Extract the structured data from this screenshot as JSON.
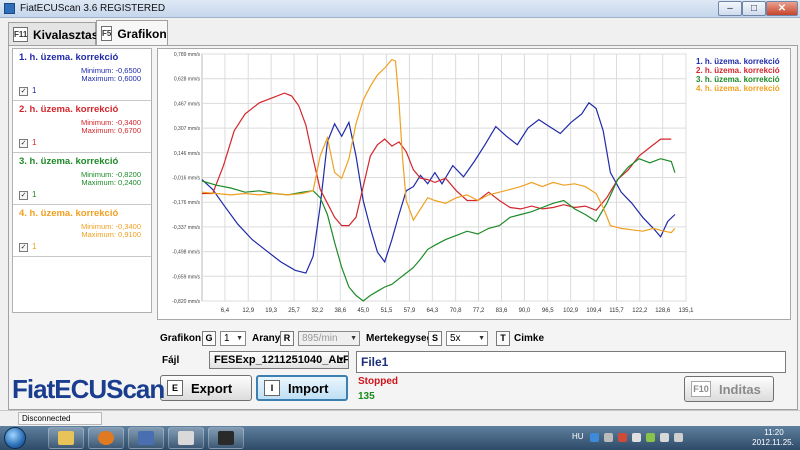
{
  "window": {
    "title": "FiatECUScan 3.6 REGISTERED",
    "minimize": "–",
    "maximize": "□",
    "close": "✕"
  },
  "tabs": [
    {
      "key": "F11",
      "label": "Kivalasztas",
      "active": false
    },
    {
      "key": "F5",
      "label": "Grafikon",
      "active": true
    }
  ],
  "channels": [
    {
      "title": "1. h. üzema. korrekció",
      "min": "Minimum: -0,6500",
      "max": "Maximum: 0,6000",
      "num": "1",
      "color": "#1f2aa8"
    },
    {
      "title": "2. h. üzema. korrekció",
      "min": "Minimum: -0,3400",
      "max": "Maximum: 0,6700",
      "num": "1",
      "color": "#d3262c"
    },
    {
      "title": "3. h. üzema. korrekció",
      "min": "Minimum: -0,8200",
      "max": "Maximum: 0,2400",
      "num": "1",
      "color": "#1d8a28"
    },
    {
      "title": "4. h. üzema. korrekció",
      "min": "Minimum: -0,3400",
      "max": "Maximum: 0,9100",
      "num": "1",
      "color": "#f0a020"
    }
  ],
  "chart_data": {
    "type": "line",
    "y_ticks": [
      "0,789 mm/s",
      "0,628 mm/s",
      "0,467 mm/s",
      "0,307 mm/s",
      "0,146 mm/s",
      "-0,016 mm/s",
      "-0,176 mm/s",
      "-0,337 mm/s",
      "-0,498 mm/s",
      "-0,659 mm/s",
      "-0,820 mm/s"
    ],
    "x_ticks": [
      "6,4",
      "12,9",
      "19,3",
      "25,7",
      "32,2",
      "38,6",
      "45,0",
      "51,5",
      "57,9",
      "64,3",
      "70,8",
      "77,2",
      "83,6",
      "90,0",
      "96,5",
      "102,9",
      "109,4",
      "115,7",
      "122,2",
      "128,6",
      "135,1"
    ],
    "xlim": [
      0,
      135.1
    ],
    "ylim": [
      -0.82,
      0.95
    ],
    "grid": true,
    "legend_position": "top-right",
    "series": [
      {
        "name": "1. h. üzema. korrekció",
        "color": "#1f2aa8",
        "points": [
          [
            0,
            0.05
          ],
          [
            3,
            -0.02
          ],
          [
            6,
            -0.13
          ],
          [
            10,
            -0.27
          ],
          [
            14,
            -0.38
          ],
          [
            18,
            -0.46
          ],
          [
            22,
            -0.54
          ],
          [
            26,
            -0.6
          ],
          [
            29,
            -0.62
          ],
          [
            31,
            -0.5
          ],
          [
            33,
            -0.14
          ],
          [
            35,
            0.32
          ],
          [
            37,
            0.45
          ],
          [
            39,
            0.36
          ],
          [
            41,
            0.46
          ],
          [
            43,
            0.22
          ],
          [
            45,
            -0.1
          ],
          [
            47,
            -0.3
          ],
          [
            49,
            -0.47
          ],
          [
            51,
            -0.54
          ],
          [
            53,
            -0.38
          ],
          [
            55,
            -0.2
          ],
          [
            57,
            -0.03
          ],
          [
            59,
            0.0
          ],
          [
            61,
            0.08
          ],
          [
            63,
            0.02
          ],
          [
            65,
            0.1
          ],
          [
            67,
            0.02
          ],
          [
            70,
            0.15
          ],
          [
            73,
            0.07
          ],
          [
            76,
            0.18
          ],
          [
            79,
            0.3
          ],
          [
            82,
            0.43
          ],
          [
            85,
            0.36
          ],
          [
            88,
            0.3
          ],
          [
            91,
            0.42
          ],
          [
            94,
            0.48
          ],
          [
            97,
            0.43
          ],
          [
            100,
            0.38
          ],
          [
            103,
            0.46
          ],
          [
            106,
            0.52
          ],
          [
            108,
            0.6
          ],
          [
            110,
            0.56
          ],
          [
            112,
            0.4
          ],
          [
            114,
            0.1
          ],
          [
            117,
            -0.04
          ],
          [
            120,
            -0.12
          ],
          [
            123,
            -0.22
          ],
          [
            126,
            -0.3
          ],
          [
            128,
            -0.36
          ],
          [
            130,
            -0.25
          ],
          [
            132,
            -0.2
          ]
        ]
      },
      {
        "name": "2. h. üzema. korrekció",
        "color": "#d3262c",
        "points": [
          [
            0,
            -0.05
          ],
          [
            3,
            -0.05
          ],
          [
            6,
            0.15
          ],
          [
            9,
            0.4
          ],
          [
            12,
            0.52
          ],
          [
            16,
            0.6
          ],
          [
            20,
            0.64
          ],
          [
            23,
            0.67
          ],
          [
            25,
            0.65
          ],
          [
            27,
            0.58
          ],
          [
            29,
            0.44
          ],
          [
            31,
            0.2
          ],
          [
            33,
            -0.02
          ],
          [
            35,
            -0.12
          ],
          [
            37,
            -0.22
          ],
          [
            39,
            -0.28
          ],
          [
            41,
            -0.28
          ],
          [
            43,
            -0.22
          ],
          [
            45,
            0.0
          ],
          [
            47,
            0.22
          ],
          [
            49,
            0.3
          ],
          [
            51,
            0.34
          ],
          [
            53,
            0.29
          ],
          [
            55,
            0.32
          ],
          [
            57,
            0.25
          ],
          [
            59,
            0.12
          ],
          [
            61,
            0.06
          ],
          [
            63,
            0.05
          ],
          [
            65,
            0.03
          ],
          [
            68,
            0.06
          ],
          [
            71,
            -0.03
          ],
          [
            74,
            -0.1
          ],
          [
            77,
            -0.1
          ],
          [
            80,
            -0.04
          ],
          [
            83,
            -0.1
          ],
          [
            86,
            -0.15
          ],
          [
            89,
            -0.16
          ],
          [
            92,
            -0.14
          ],
          [
            95,
            -0.16
          ],
          [
            98,
            -0.15
          ],
          [
            101,
            -0.13
          ],
          [
            104,
            -0.15
          ],
          [
            107,
            -0.14
          ],
          [
            110,
            -0.17
          ],
          [
            113,
            -0.08
          ],
          [
            116,
            0.05
          ],
          [
            119,
            0.12
          ],
          [
            122,
            0.22
          ],
          [
            125,
            0.28
          ],
          [
            128,
            0.34
          ],
          [
            131,
            0.34
          ]
        ]
      },
      {
        "name": "3. h. üzema. korrekció",
        "color": "#1d8a28",
        "points": [
          [
            0,
            0.04
          ],
          [
            4,
            0.01
          ],
          [
            8,
            -0.01
          ],
          [
            12,
            -0.04
          ],
          [
            16,
            -0.03
          ],
          [
            20,
            -0.05
          ],
          [
            24,
            -0.06
          ],
          [
            28,
            -0.04
          ],
          [
            31,
            -0.03
          ],
          [
            33,
            -0.08
          ],
          [
            35,
            -0.2
          ],
          [
            37,
            -0.4
          ],
          [
            39,
            -0.58
          ],
          [
            41,
            -0.72
          ],
          [
            43,
            -0.78
          ],
          [
            45,
            -0.82
          ],
          [
            47,
            -0.78
          ],
          [
            49,
            -0.75
          ],
          [
            51,
            -0.72
          ],
          [
            53,
            -0.7
          ],
          [
            55,
            -0.66
          ],
          [
            57,
            -0.62
          ],
          [
            59,
            -0.58
          ],
          [
            61,
            -0.52
          ],
          [
            63,
            -0.45
          ],
          [
            65,
            -0.42
          ],
          [
            68,
            -0.38
          ],
          [
            71,
            -0.35
          ],
          [
            74,
            -0.32
          ],
          [
            77,
            -0.34
          ],
          [
            80,
            -0.3
          ],
          [
            83,
            -0.28
          ],
          [
            86,
            -0.22
          ],
          [
            89,
            -0.2
          ],
          [
            92,
            -0.18
          ],
          [
            95,
            -0.15
          ],
          [
            98,
            -0.12
          ],
          [
            101,
            -0.1
          ],
          [
            104,
            -0.16
          ],
          [
            107,
            -0.2
          ],
          [
            110,
            -0.25
          ],
          [
            113,
            -0.12
          ],
          [
            116,
            0.05
          ],
          [
            119,
            0.14
          ],
          [
            122,
            0.2
          ],
          [
            125,
            0.17
          ],
          [
            128,
            0.2
          ],
          [
            131,
            0.18
          ],
          [
            132,
            0.1
          ]
        ]
      },
      {
        "name": "4. h. üzema. korrekció",
        "color": "#f0a020",
        "points": [
          [
            0,
            -0.04
          ],
          [
            4,
            -0.05
          ],
          [
            8,
            -0.06
          ],
          [
            12,
            -0.05
          ],
          [
            16,
            -0.06
          ],
          [
            20,
            -0.05
          ],
          [
            24,
            -0.06
          ],
          [
            28,
            -0.05
          ],
          [
            31,
            -0.03
          ],
          [
            33,
            0.22
          ],
          [
            35,
            0.35
          ],
          [
            37,
            0.1
          ],
          [
            39,
            0.06
          ],
          [
            41,
            0.2
          ],
          [
            43,
            0.45
          ],
          [
            45,
            0.62
          ],
          [
            47,
            0.72
          ],
          [
            49,
            0.8
          ],
          [
            51,
            0.85
          ],
          [
            53,
            0.91
          ],
          [
            54,
            0.9
          ],
          [
            55,
            0.6
          ],
          [
            56,
            0.2
          ],
          [
            57,
            -0.1
          ],
          [
            59,
            -0.24
          ],
          [
            61,
            -0.16
          ],
          [
            63,
            -0.08
          ],
          [
            65,
            -0.1
          ],
          [
            68,
            -0.12
          ],
          [
            71,
            -0.08
          ],
          [
            74,
            -0.06
          ],
          [
            77,
            -0.1
          ],
          [
            80,
            -0.06
          ],
          [
            83,
            -0.04
          ],
          [
            86,
            -0.02
          ],
          [
            89,
            0.0
          ],
          [
            92,
            0.03
          ],
          [
            95,
            0.0
          ],
          [
            98,
            0.03
          ],
          [
            101,
            0.01
          ],
          [
            104,
            0.02
          ],
          [
            107,
            0.0
          ],
          [
            110,
            -0.05
          ],
          [
            112,
            -0.15
          ],
          [
            114,
            -0.28
          ],
          [
            117,
            -0.3
          ],
          [
            120,
            -0.31
          ],
          [
            123,
            -0.32
          ],
          [
            126,
            -0.3
          ],
          [
            129,
            -0.32
          ],
          [
            131,
            -0.33
          ],
          [
            132,
            -0.3
          ]
        ]
      }
    ]
  },
  "controls": {
    "grafikon_label": "Grafikon",
    "grafikon_key": "G",
    "grafikon_value": "1",
    "arany_label": "Arany",
    "arany_key": "R",
    "arany_value": "895/min",
    "mertekegyseg_label": "Mertekegyseg",
    "mertekegyseg_key": "S",
    "mertekegyseg_value": "5x",
    "cimke_key": "T",
    "cimke_label": "Cimke",
    "fajl_label": "Fájl",
    "fajl_value": "FESExp_1211251040_ALFA",
    "export_key": "E",
    "export_label": "Export",
    "import_key": "I",
    "import_label": "Import",
    "inditas_key": "F10",
    "inditas_label": "Inditas",
    "file_name": "File1",
    "status": "Stopped",
    "count": "135"
  },
  "logo": "FiatECUScan",
  "statusbar": {
    "connection": "Disconnected"
  },
  "taskbar": {
    "lang": "HU",
    "time": "11:20",
    "date": "2012.11.25."
  }
}
